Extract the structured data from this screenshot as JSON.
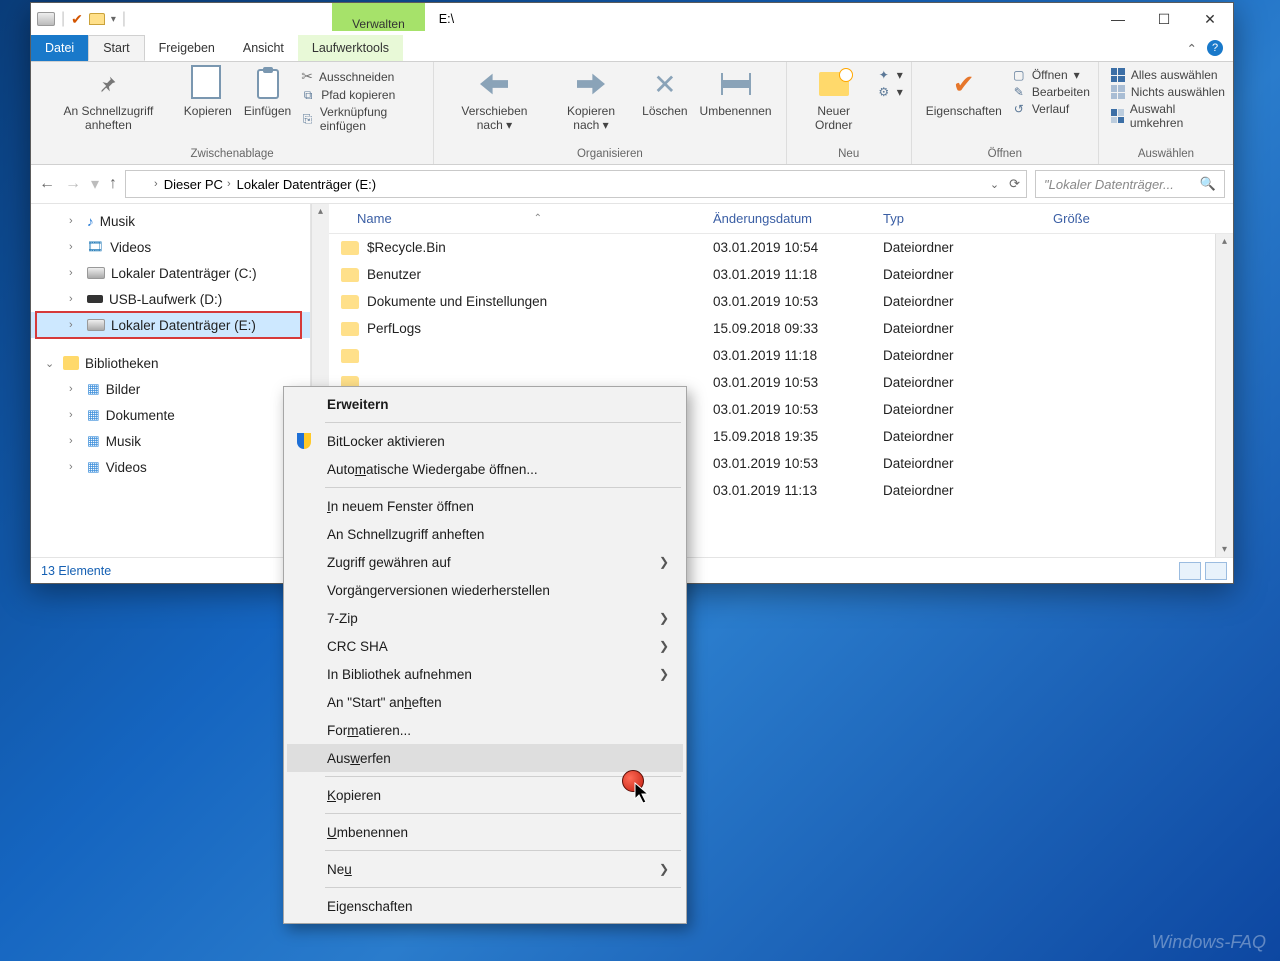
{
  "window": {
    "title": "E:\\",
    "verwalten": "Verwalten",
    "tabs": {
      "datei": "Datei",
      "start": "Start",
      "freigeben": "Freigeben",
      "ansicht": "Ansicht",
      "tools": "Laufwerktools"
    }
  },
  "ribbon": {
    "clipboard": {
      "label": "Zwischenablage",
      "pin": "An Schnellzugriff anheften",
      "copy": "Kopieren",
      "paste": "Einfügen",
      "cut": "Ausschneiden",
      "copypath": "Pfad kopieren",
      "shortcut": "Verknüpfung einfügen"
    },
    "organize": {
      "label": "Organisieren",
      "moveto": "Verschieben nach",
      "copyto": "Kopieren nach",
      "delete": "Löschen",
      "rename": "Umbenennen"
    },
    "new": {
      "label": "Neu",
      "folder": "Neuer Ordner"
    },
    "open": {
      "label": "Öffnen",
      "props": "Eigenschaften",
      "open": "Öffnen",
      "edit": "Bearbeiten",
      "history": "Verlauf"
    },
    "select": {
      "label": "Auswählen",
      "all": "Alles auswählen",
      "none": "Nichts auswählen",
      "invert": "Auswahl umkehren"
    }
  },
  "address": {
    "pc": "Dieser PC",
    "drive": "Lokaler Datenträger (E:)",
    "search_placeholder": "\"Lokaler Datenträger..."
  },
  "nav": {
    "items": [
      {
        "label": "Musik",
        "icon": "music"
      },
      {
        "label": "Videos",
        "icon": "video"
      },
      {
        "label": "Lokaler Datenträger (C:)",
        "icon": "drive"
      },
      {
        "label": "USB-Laufwerk (D:)",
        "icon": "usb"
      },
      {
        "label": "Lokaler Datenträger (E:)",
        "icon": "drive",
        "selected": true
      }
    ],
    "lib_header": "Bibliotheken",
    "libs": [
      {
        "label": "Bilder"
      },
      {
        "label": "Dokumente"
      },
      {
        "label": "Musik"
      },
      {
        "label": "Videos"
      }
    ]
  },
  "columns": {
    "name": "Name",
    "date": "Änderungsdatum",
    "type": "Typ",
    "size": "Größe"
  },
  "rows": [
    {
      "name": "$Recycle.Bin",
      "date": "03.01.2019 10:54",
      "type": "Dateiordner"
    },
    {
      "name": "Benutzer",
      "date": "03.01.2019 11:18",
      "type": "Dateiordner"
    },
    {
      "name": "Dokumente und Einstellungen",
      "date": "03.01.2019 10:53",
      "type": "Dateiordner"
    },
    {
      "name": "PerfLogs",
      "date": "15.09.2018 09:33",
      "type": "Dateiordner"
    },
    {
      "name": "",
      "date": "03.01.2019 11:18",
      "type": "Dateiordner"
    },
    {
      "name": "",
      "date": "03.01.2019 10:53",
      "type": "Dateiordner"
    },
    {
      "name": "",
      "date": "03.01.2019 10:53",
      "type": "Dateiordner"
    },
    {
      "name": "",
      "date": "15.09.2018 19:35",
      "type": "Dateiordner"
    },
    {
      "name": "",
      "date": "03.01.2019 10:53",
      "type": "Dateiordner"
    },
    {
      "name": "",
      "date": "03.01.2019 11:13",
      "type": "Dateiordner"
    }
  ],
  "status": "13 Elemente",
  "context_menu": {
    "expand": "Erweitern",
    "bitlocker": "BitLocker aktivieren",
    "autoplay_pre": "Auto",
    "autoplay_u": "m",
    "autoplay_post": "atische Wiedergabe öffnen...",
    "newwin_pre": "",
    "newwin_u": "I",
    "newwin_post": "n neuem Fenster öffnen",
    "pinquick": "An Schnellzugriff anheften",
    "grant": "Zugriff gewähren auf",
    "prev": "Vorgängerversionen wiederherstellen",
    "sevenzip": "7-Zip",
    "crc": "CRC SHA",
    "addlib": "In Bibliothek aufnehmen",
    "pinstart_pre": "An \"Start\" an",
    "pinstart_u": "h",
    "pinstart_post": "eften",
    "format_pre": "For",
    "format_u": "m",
    "format_post": "atieren...",
    "eject_pre": "Aus",
    "eject_u": "w",
    "eject_post": "erfen",
    "copy_pre": "",
    "copy_u": "K",
    "copy_post": "opieren",
    "rename_pre": "",
    "rename_u": "U",
    "rename_post": "mbenennen",
    "neu_pre": "Ne",
    "neu_u": "u",
    "neu_post": "",
    "props": "Eigenschaften"
  },
  "watermark": "Windows-FAQ"
}
